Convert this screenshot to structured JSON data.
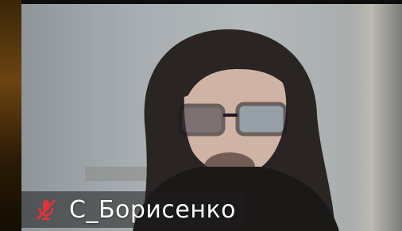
{
  "participant": {
    "name": "С_Борисенко",
    "mic_state": "muted",
    "mic_icon": "mic-muted-icon"
  },
  "colors": {
    "mic_muted": "#e0323a",
    "name_text": "#ffffff"
  }
}
